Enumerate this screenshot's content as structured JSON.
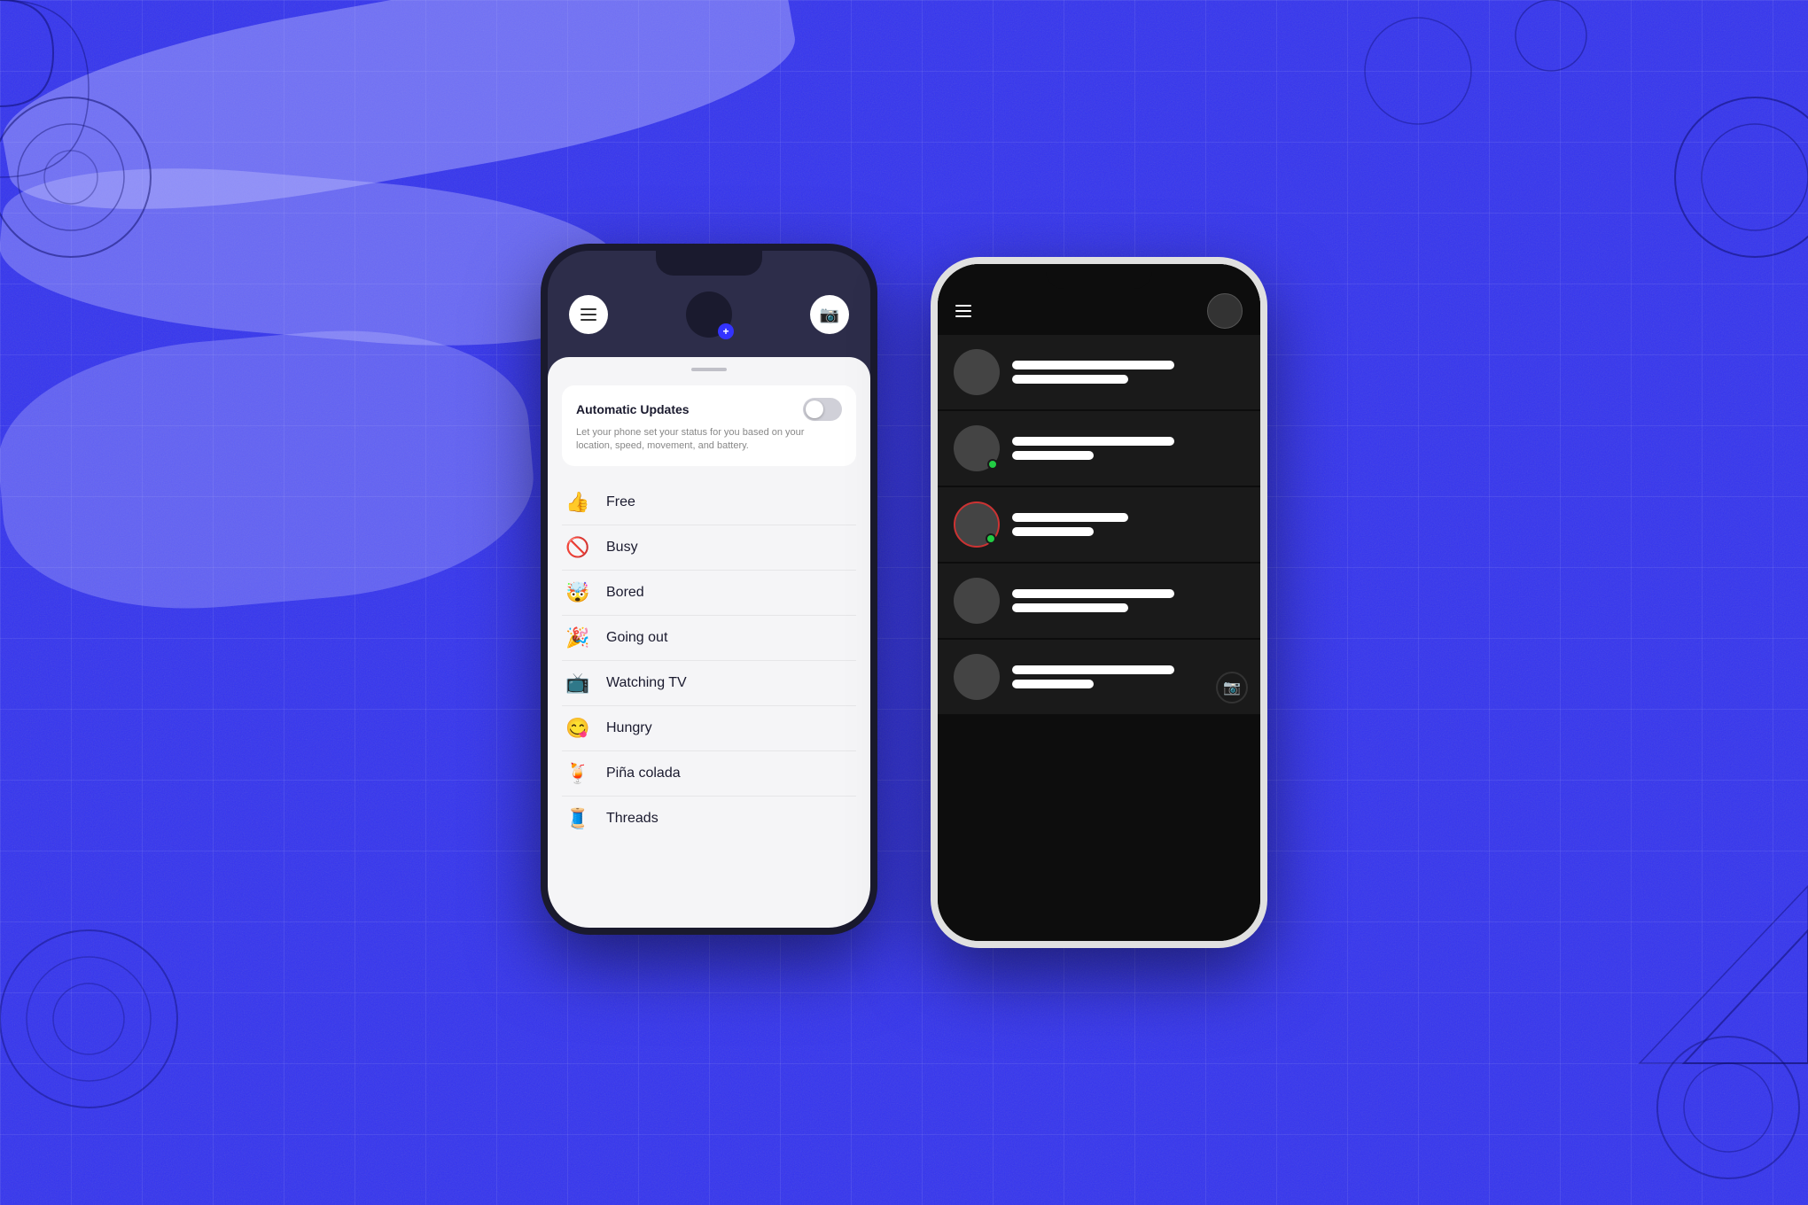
{
  "background": {
    "color": "#3333ee"
  },
  "phone1": {
    "header": {
      "menu_label": "≡",
      "camera_label": "📷",
      "avatar_plus": "+"
    },
    "auto_updates": {
      "title": "Automatic Updates",
      "description": "Let your phone set your status for you based on your location, speed, movement, and battery.",
      "toggle_state": false
    },
    "status_items": [
      {
        "emoji": "👍",
        "label": "Free"
      },
      {
        "emoji": "🚫",
        "label": "Busy"
      },
      {
        "emoji": "🤯",
        "label": "Bored"
      },
      {
        "emoji": "🎉",
        "label": "Going out"
      },
      {
        "emoji": "📺",
        "label": "Watching TV"
      },
      {
        "emoji": "😋",
        "label": "Hungry"
      },
      {
        "emoji": "🍹",
        "label": "Piña colada"
      },
      {
        "emoji": "🧵",
        "label": "Threads"
      }
    ]
  },
  "phone2": {
    "contacts": [
      {
        "has_ring": false,
        "has_dot": false,
        "bars": [
          "long",
          "medium"
        ]
      },
      {
        "has_ring": false,
        "has_dot": true,
        "bars": [
          "long",
          "short"
        ]
      },
      {
        "has_ring": true,
        "has_dot": true,
        "bars": [
          "medium",
          "short"
        ]
      },
      {
        "has_ring": false,
        "has_dot": false,
        "bars": [
          "long",
          "medium"
        ]
      },
      {
        "has_ring": false,
        "has_dot": false,
        "has_camera": true,
        "bars": [
          "long",
          "short"
        ]
      }
    ]
  }
}
